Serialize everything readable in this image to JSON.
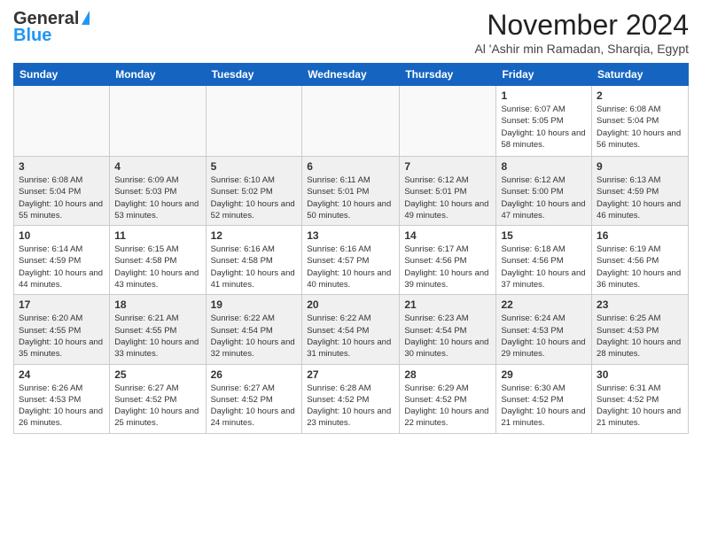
{
  "header": {
    "logo_line1": "General",
    "logo_line2": "Blue",
    "month": "November 2024",
    "location": "Al 'Ashir min Ramadan, Sharqia, Egypt"
  },
  "days_of_week": [
    "Sunday",
    "Monday",
    "Tuesday",
    "Wednesday",
    "Thursday",
    "Friday",
    "Saturday"
  ],
  "weeks": [
    [
      {
        "day": "",
        "info": ""
      },
      {
        "day": "",
        "info": ""
      },
      {
        "day": "",
        "info": ""
      },
      {
        "day": "",
        "info": ""
      },
      {
        "day": "",
        "info": ""
      },
      {
        "day": "1",
        "info": "Sunrise: 6:07 AM\nSunset: 5:05 PM\nDaylight: 10 hours and 58 minutes."
      },
      {
        "day": "2",
        "info": "Sunrise: 6:08 AM\nSunset: 5:04 PM\nDaylight: 10 hours and 56 minutes."
      }
    ],
    [
      {
        "day": "3",
        "info": "Sunrise: 6:08 AM\nSunset: 5:04 PM\nDaylight: 10 hours and 55 minutes."
      },
      {
        "day": "4",
        "info": "Sunrise: 6:09 AM\nSunset: 5:03 PM\nDaylight: 10 hours and 53 minutes."
      },
      {
        "day": "5",
        "info": "Sunrise: 6:10 AM\nSunset: 5:02 PM\nDaylight: 10 hours and 52 minutes."
      },
      {
        "day": "6",
        "info": "Sunrise: 6:11 AM\nSunset: 5:01 PM\nDaylight: 10 hours and 50 minutes."
      },
      {
        "day": "7",
        "info": "Sunrise: 6:12 AM\nSunset: 5:01 PM\nDaylight: 10 hours and 49 minutes."
      },
      {
        "day": "8",
        "info": "Sunrise: 6:12 AM\nSunset: 5:00 PM\nDaylight: 10 hours and 47 minutes."
      },
      {
        "day": "9",
        "info": "Sunrise: 6:13 AM\nSunset: 4:59 PM\nDaylight: 10 hours and 46 minutes."
      }
    ],
    [
      {
        "day": "10",
        "info": "Sunrise: 6:14 AM\nSunset: 4:59 PM\nDaylight: 10 hours and 44 minutes."
      },
      {
        "day": "11",
        "info": "Sunrise: 6:15 AM\nSunset: 4:58 PM\nDaylight: 10 hours and 43 minutes."
      },
      {
        "day": "12",
        "info": "Sunrise: 6:16 AM\nSunset: 4:58 PM\nDaylight: 10 hours and 41 minutes."
      },
      {
        "day": "13",
        "info": "Sunrise: 6:16 AM\nSunset: 4:57 PM\nDaylight: 10 hours and 40 minutes."
      },
      {
        "day": "14",
        "info": "Sunrise: 6:17 AM\nSunset: 4:56 PM\nDaylight: 10 hours and 39 minutes."
      },
      {
        "day": "15",
        "info": "Sunrise: 6:18 AM\nSunset: 4:56 PM\nDaylight: 10 hours and 37 minutes."
      },
      {
        "day": "16",
        "info": "Sunrise: 6:19 AM\nSunset: 4:56 PM\nDaylight: 10 hours and 36 minutes."
      }
    ],
    [
      {
        "day": "17",
        "info": "Sunrise: 6:20 AM\nSunset: 4:55 PM\nDaylight: 10 hours and 35 minutes."
      },
      {
        "day": "18",
        "info": "Sunrise: 6:21 AM\nSunset: 4:55 PM\nDaylight: 10 hours and 33 minutes."
      },
      {
        "day": "19",
        "info": "Sunrise: 6:22 AM\nSunset: 4:54 PM\nDaylight: 10 hours and 32 minutes."
      },
      {
        "day": "20",
        "info": "Sunrise: 6:22 AM\nSunset: 4:54 PM\nDaylight: 10 hours and 31 minutes."
      },
      {
        "day": "21",
        "info": "Sunrise: 6:23 AM\nSunset: 4:54 PM\nDaylight: 10 hours and 30 minutes."
      },
      {
        "day": "22",
        "info": "Sunrise: 6:24 AM\nSunset: 4:53 PM\nDaylight: 10 hours and 29 minutes."
      },
      {
        "day": "23",
        "info": "Sunrise: 6:25 AM\nSunset: 4:53 PM\nDaylight: 10 hours and 28 minutes."
      }
    ],
    [
      {
        "day": "24",
        "info": "Sunrise: 6:26 AM\nSunset: 4:53 PM\nDaylight: 10 hours and 26 minutes."
      },
      {
        "day": "25",
        "info": "Sunrise: 6:27 AM\nSunset: 4:52 PM\nDaylight: 10 hours and 25 minutes."
      },
      {
        "day": "26",
        "info": "Sunrise: 6:27 AM\nSunset: 4:52 PM\nDaylight: 10 hours and 24 minutes."
      },
      {
        "day": "27",
        "info": "Sunrise: 6:28 AM\nSunset: 4:52 PM\nDaylight: 10 hours and 23 minutes."
      },
      {
        "day": "28",
        "info": "Sunrise: 6:29 AM\nSunset: 4:52 PM\nDaylight: 10 hours and 22 minutes."
      },
      {
        "day": "29",
        "info": "Sunrise: 6:30 AM\nSunset: 4:52 PM\nDaylight: 10 hours and 21 minutes."
      },
      {
        "day": "30",
        "info": "Sunrise: 6:31 AM\nSunset: 4:52 PM\nDaylight: 10 hours and 21 minutes."
      }
    ]
  ]
}
